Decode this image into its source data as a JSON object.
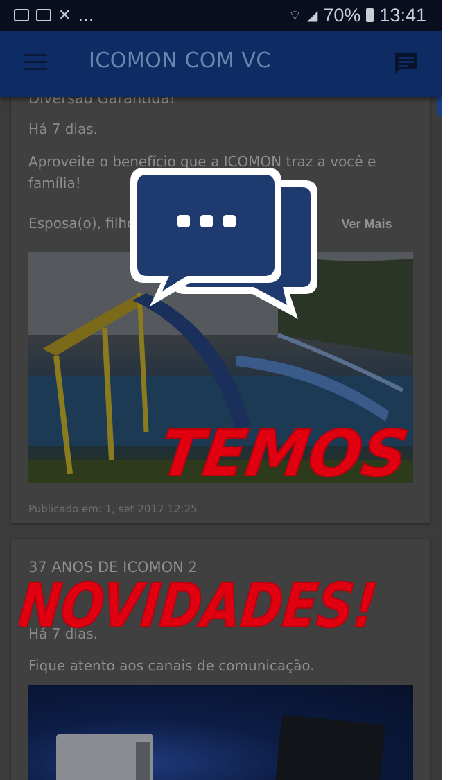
{
  "status_bar": {
    "battery": "70%",
    "time": "13:41",
    "ellipsis": "..."
  },
  "app_bar": {
    "title": "ICOMON COM VC"
  },
  "posts": [
    {
      "title": "Diversão Garantida!",
      "age": "Há 7 dias.",
      "body_line1": "Aproveite o benefício que a ICOMON traz a você e família!",
      "body_line2": "Esposa(o), filhos ... ",
      "ver_mais": "Ver Mais",
      "published": "Publicado em: 1, set 2017 12:25"
    },
    {
      "title": "37 ANOS DE ICOMON 2",
      "age": "Há 7 dias.",
      "body": "Fique atento aos canais de comunicação."
    }
  ],
  "overlay": {
    "word1": "TEMOS",
    "word2": "NOVIDADES!"
  },
  "colors": {
    "appbar": "#0e2c63",
    "bubble": "#1f3a6e",
    "brush_red": "#e00010"
  }
}
